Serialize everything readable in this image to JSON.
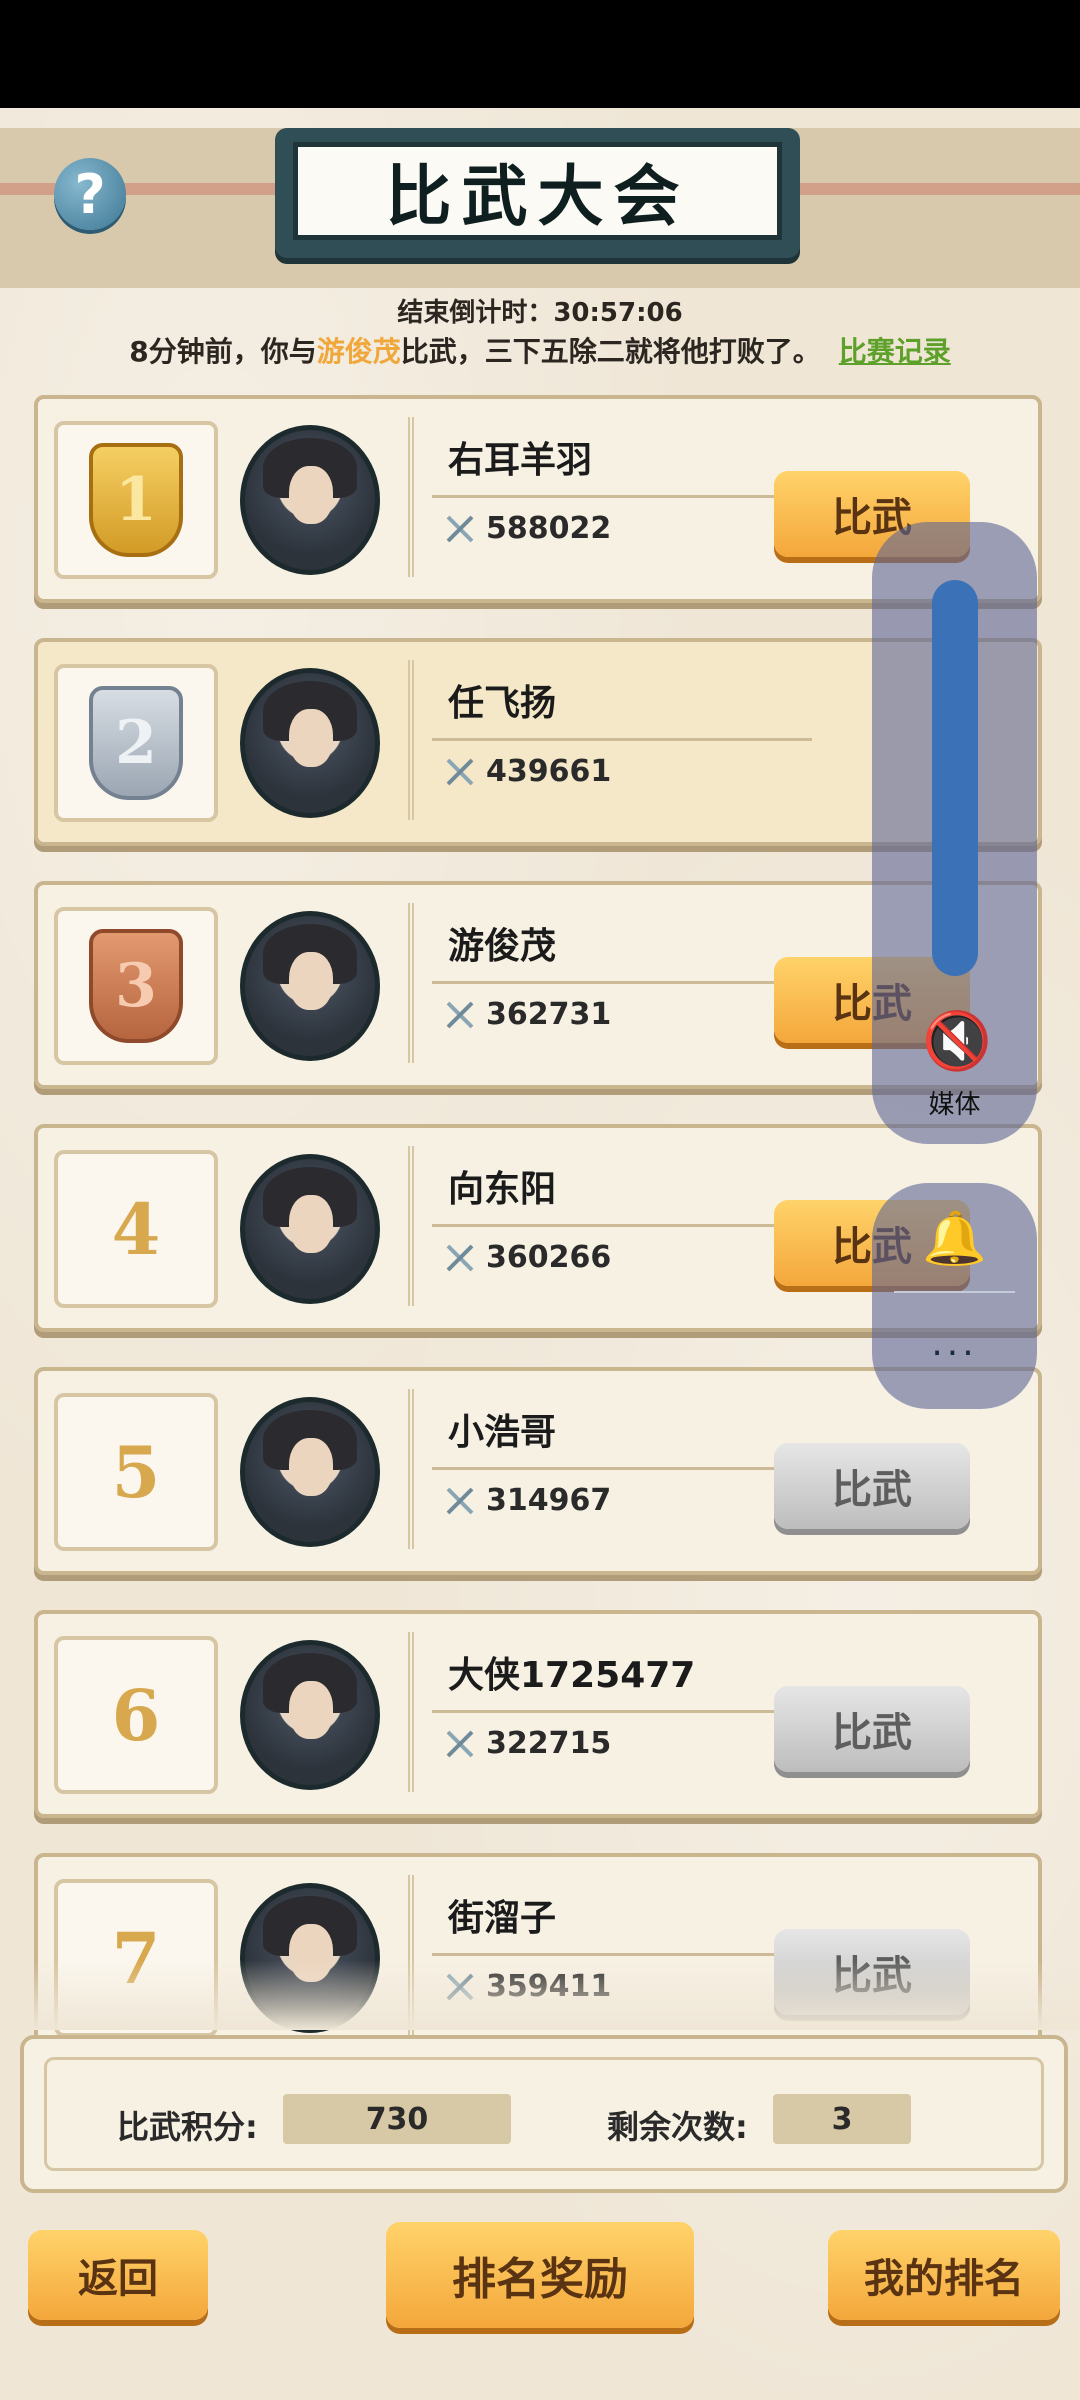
{
  "header": {
    "title": "比武大会",
    "help_icon": "?"
  },
  "countdown": "结束倒计时：30:57:06",
  "battle_msg": {
    "prefix": "8分钟前，你与",
    "highlight": "游俊茂",
    "suffix": "比武，三下五除二就将他打败了。",
    "link": "比赛记录"
  },
  "colors": {
    "highlight": "#f0a73b",
    "link": "#5ea12a",
    "button_orange": "#f4a73b",
    "button_gray": "#bdbdbd"
  },
  "players": [
    {
      "rank": "1",
      "name": "右耳羊羽",
      "power": "588022",
      "button": "比武",
      "button_style": "orange",
      "medal": "gold"
    },
    {
      "rank": "2",
      "name": "任飞扬",
      "power": "439661",
      "button": "",
      "button_style": "none",
      "medal": "silver",
      "self": true
    },
    {
      "rank": "3",
      "name": "游俊茂",
      "power": "362731",
      "button": "比武",
      "button_style": "orange",
      "medal": "bronze"
    },
    {
      "rank": "4",
      "name": "向东阳",
      "power": "360266",
      "button": "比武",
      "button_style": "orange"
    },
    {
      "rank": "5",
      "name": "小浩哥",
      "power": "314967",
      "button": "比武",
      "button_style": "gray"
    },
    {
      "rank": "6",
      "name": "大侠1725477",
      "power": "322715",
      "button": "比武",
      "button_style": "gray"
    },
    {
      "rank": "7",
      "name": "街溜子",
      "power": "359411",
      "button": "比武",
      "button_style": "gray"
    }
  ],
  "score_panel": {
    "points_label": "比武积分:",
    "points_value": "730",
    "remaining_label": "剩余次数:",
    "remaining_value": "3"
  },
  "bottom": {
    "back": "返回",
    "rewards": "排名奖励",
    "my_rank": "我的排名"
  },
  "system_overlay": {
    "volume_label": "媒体",
    "mute_icon": "speaker-muted-icon",
    "bell_icon": "bell-icon",
    "more": "..."
  }
}
